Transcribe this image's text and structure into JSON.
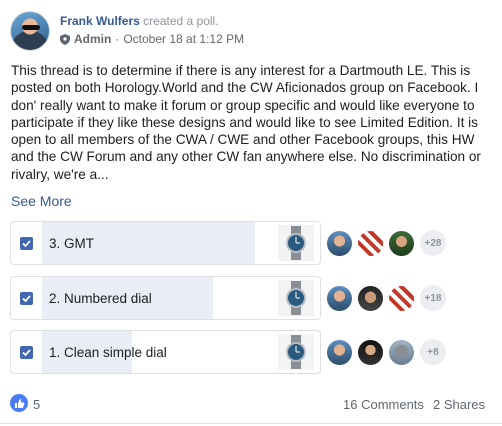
{
  "post": {
    "author": "Frank Wulfers",
    "action": "created a poll.",
    "role": "Admin",
    "separator": "·",
    "date": "October 18 at 1:12 PM",
    "text": "This thread is to determine if there is any interest for a Dartmouth LE. This is posted on both Horology.World and the CW Aficionados group on Facebook. I don' really want to make it forum or group specific and would like everyone to participate if they like these designs and would like to see Limited Edition. It is open to all members of the CWA / CWE and other Facebook groups, this HW and the CW Forum and any other CW fan anywhere else. No discrimination or rivalry, we're a...",
    "see_more": "See More"
  },
  "poll": {
    "options": [
      {
        "label": "3. GMT",
        "checked": true,
        "share": 0.76,
        "extra_voters": "+28",
        "thumb_icon": "watch-icon"
      },
      {
        "label": "2. Numbered dial",
        "checked": true,
        "share": 0.61,
        "extra_voters": "+18",
        "thumb_icon": "watch-icon"
      },
      {
        "label": "1. Clean simple dial",
        "checked": true,
        "share": 0.32,
        "extra_voters": "+8",
        "thumb_icon": "watch-icon"
      }
    ]
  },
  "footer": {
    "likes": "5",
    "comments": "16 Comments",
    "shares": "2 Shares"
  },
  "colors": {
    "link": "#385898",
    "accent": "#4267b2",
    "poll_fill": "#e9edf5",
    "like": "#4a7cf7"
  }
}
